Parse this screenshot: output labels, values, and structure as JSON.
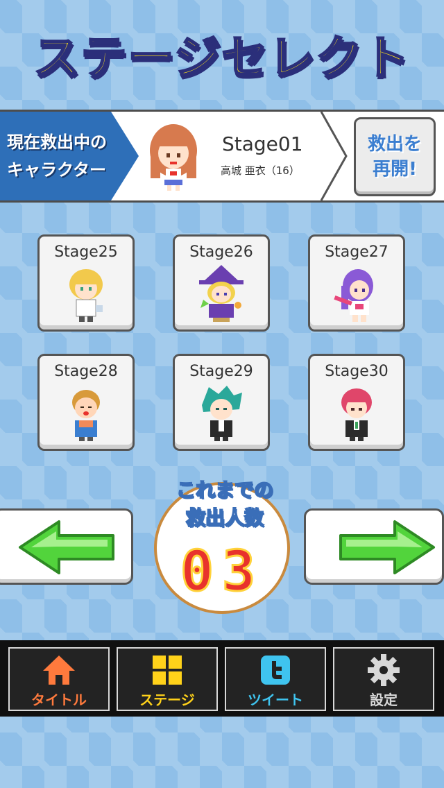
{
  "title": "ステージセレクト",
  "current": {
    "label_line1": "現在救出中の",
    "label_line2": "キャラクター",
    "stage": "Stage01",
    "name": "高城 亜衣（16）",
    "resume_line1": "救出を",
    "resume_line2": "再開!"
  },
  "stages": [
    {
      "label": "Stage25"
    },
    {
      "label": "Stage26"
    },
    {
      "label": "Stage27"
    },
    {
      "label": "Stage28"
    },
    {
      "label": "Stage29"
    },
    {
      "label": "Stage30"
    }
  ],
  "counter": {
    "caption_line1": "これまでの",
    "caption_line2": "救出人数",
    "value": "03"
  },
  "nav": [
    {
      "label": "タイトル",
      "icon": "home-icon",
      "color": "#ff7a3d"
    },
    {
      "label": "ステージ",
      "icon": "grid-icon",
      "color": "#ffd21a"
    },
    {
      "label": "ツイート",
      "icon": "twitter-icon",
      "color": "#3fc4ef"
    },
    {
      "label": "設定",
      "icon": "gear-icon",
      "color": "#d8d8d8"
    }
  ],
  "colors": {
    "background": "#8fbfe8",
    "title_fill": "#ffe31a",
    "title_outline": "#2b2f7a",
    "label_blue": "#2e6fb8",
    "arrow_green": "#52d43c",
    "counter_red": "#e8322c"
  }
}
